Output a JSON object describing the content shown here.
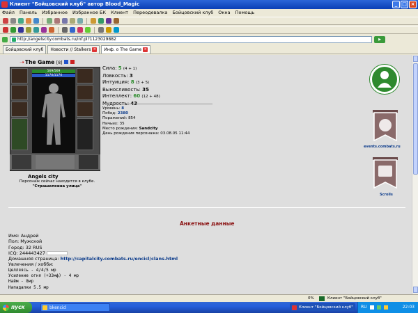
{
  "window": {
    "title": "Клиент \"Бойцовский клуб\" автор Blood_Magic"
  },
  "menu": [
    "Файл",
    "Панель",
    "Избранное",
    "Избранное БК",
    "Клиент",
    "Переодевалка",
    "Бойцовский клуб",
    "Окна",
    "Помощь"
  ],
  "address": {
    "url": "http://angelscity.combats.ru/inf.pl?1123029882"
  },
  "tabs": [
    {
      "label": "Бойцовский клуб"
    },
    {
      "label": "Новости // Stalkers"
    },
    {
      "label": "Инф. о The Game"
    }
  ],
  "character": {
    "name": "The Game",
    "level_badge": "[8]",
    "hp": "569/569",
    "mana": "1170/1170",
    "city": "Angels city",
    "location_line1": "Персонаж сейчас находится в клубе.",
    "location_line2": "\"Страшилкина улица\""
  },
  "stats": {
    "strength_label": "Сила:",
    "strength_value": "5",
    "strength_sub": "(4 + 1)",
    "agility_label": "Ловкость:",
    "agility_value": "3",
    "intuition_label": "Интуиция:",
    "intuition_value": "8",
    "intuition_sub": "(3 + 5)",
    "endurance_label": "Выносливость:",
    "endurance_value": "35",
    "intellect_label": "Интеллект:",
    "intellect_value": "60",
    "intellect_sub": "(12 + 48)",
    "wisdom_label": "Мудрость:",
    "wisdom_value": "43"
  },
  "record": {
    "level_label": "Уровень:",
    "level_value": "8",
    "wins_label": "Побед:",
    "wins_value": "2380",
    "losses_label": "Поражений:",
    "losses_value": "854",
    "draws_label": "Ничьих:",
    "draws_value": "35",
    "birthplace_label": "Место рождения:",
    "birthplace_value": "Sandcity",
    "birthday_label": "День рождения персонажа:",
    "birthday_value": "03.08.05 11:44"
  },
  "side_links": {
    "events": "events.combats.ru",
    "scrolls": "Scrolls"
  },
  "anketa": {
    "title": "Анкетные данные",
    "name": "Имя: Андрей",
    "gender": "Пол: Мужской",
    "city": "Город: 32 RUS",
    "icq": "ICQ: 244443427",
    "homepage_label": "Домашняя страница:",
    "homepage_url": "http://capitalcity.combats.ru/encicl/clans.html",
    "hobby": "Увлечения / хобби:",
    "lines": [
      "Целляясь - 4/4/5 мр",
      "Усиление огня (+33мф) - 4 мр",
      "Найм - 8мр",
      "Нападалки 5.5 мр"
    ]
  },
  "status": {
    "percent": "0%",
    "site": "Клиент \"Бойцовский клуб\""
  },
  "taskbar": {
    "start": "пуск",
    "item1": "bkencicl",
    "item2": "Клиент \"Бойцовский клуб\"",
    "lang": "RU",
    "clock": "22:03"
  }
}
